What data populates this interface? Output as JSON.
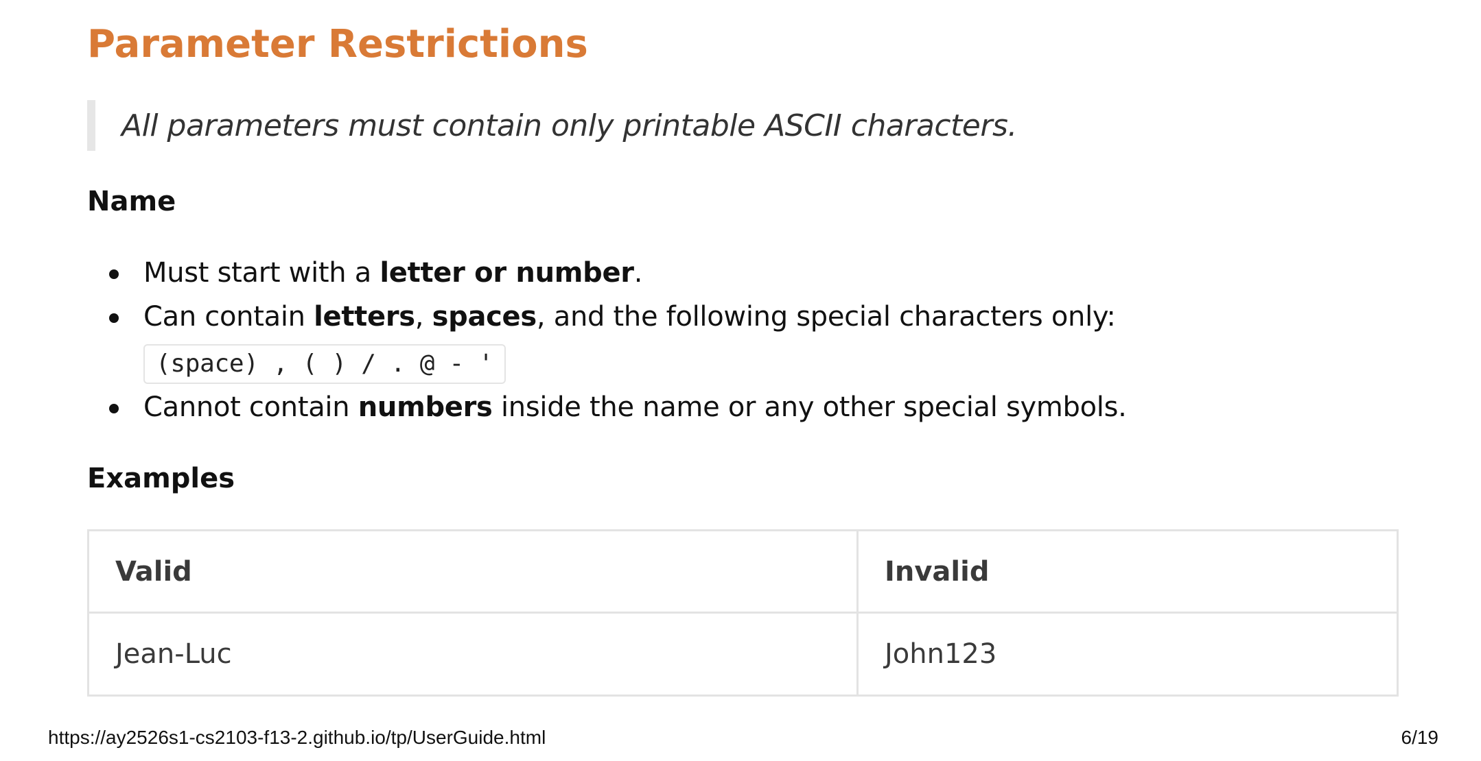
{
  "section": {
    "title": "Parameter Restrictions"
  },
  "note": {
    "text": "All parameters must contain only printable ASCII characters."
  },
  "name_section": {
    "heading": "Name",
    "rules": [
      {
        "prefix": "Must start with a ",
        "bold": "letter or number",
        "suffix": "."
      },
      {
        "prefix": "Can contain ",
        "bold1": "letters",
        "sep": ", ",
        "bold2": "spaces",
        "suffix": ", and the following special characters only:",
        "code": "(space) , ( ) / . @ - '"
      },
      {
        "prefix": "Cannot contain ",
        "bold": "numbers",
        "suffix": " inside the name or any other special symbols."
      }
    ]
  },
  "examples": {
    "heading": "Examples",
    "columns": [
      "Valid",
      "Invalid"
    ],
    "rows": [
      [
        "Jean-Luc",
        "John123"
      ]
    ]
  },
  "footer": {
    "url": "https://ay2526s1-cs2103-f13-2.github.io/tp/UserGuide.html",
    "page": "6/19"
  }
}
